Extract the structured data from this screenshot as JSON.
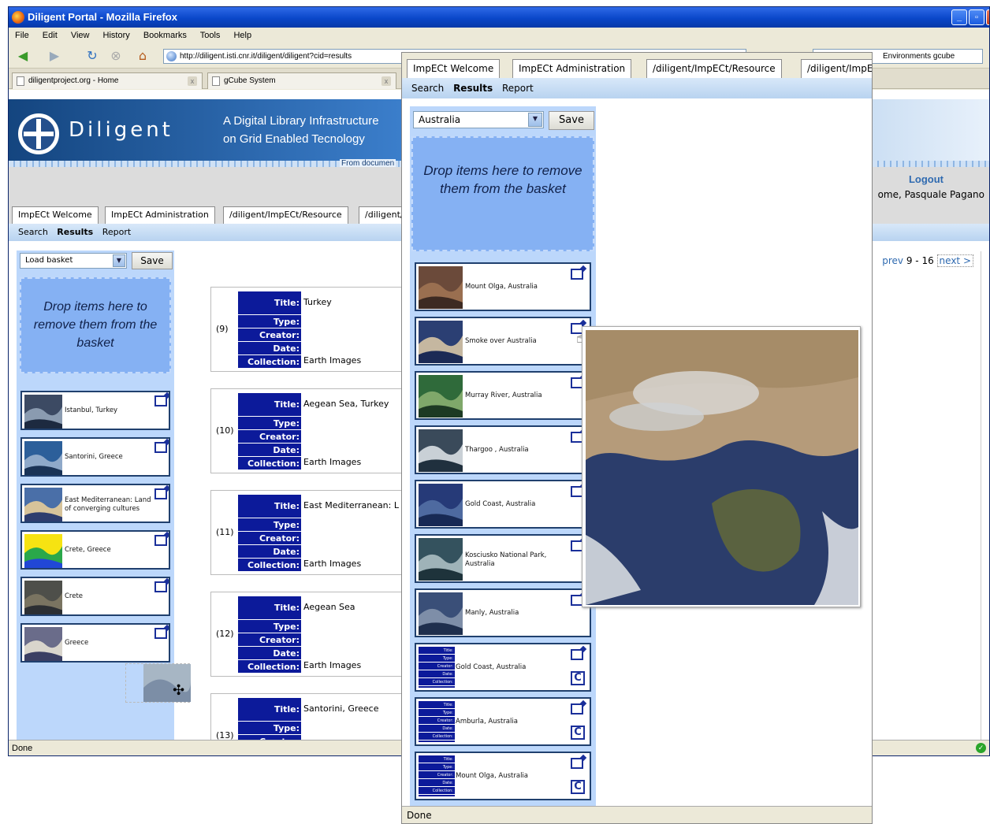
{
  "window": {
    "title": "Diligent Portal - Mozilla Firefox",
    "menu": [
      "File",
      "Edit",
      "View",
      "History",
      "Bookmarks",
      "Tools",
      "Help"
    ],
    "url": "http://diligent.isti.cnr.it/diligent/diligent?cid=results",
    "search_text": "Environments gcube",
    "browser_tabs": [
      "diligentproject.org - Home",
      "gCube System"
    ],
    "status": "Done"
  },
  "banner": {
    "logo_text": "Diligent",
    "tagline_1": "A Digital Library Infrastructure",
    "tagline_2": "on Grid Enabled Tecnology",
    "from_documents": "From documen"
  },
  "user": {
    "logout": "Logout",
    "welcome": "ome, Pasquale Pagano"
  },
  "portal_tabs": [
    "ImpECt Welcome",
    "ImpECt Administration",
    "/diligent/ImpECt/Resource",
    "/diligent/ImpECt/"
  ],
  "subnav": [
    "Search",
    "Results",
    "Report"
  ],
  "paging": {
    "prev": "prev",
    "range": "9 - 16",
    "next": "next >"
  },
  "left_basket": {
    "select_value": "Load basket",
    "save_label": "Save",
    "dropzone": "Drop items here to remove them from the basket",
    "items": [
      {
        "label": "Istanbul, Turkey"
      },
      {
        "label": "Santorini, Greece"
      },
      {
        "label": "East Mediterranean: Land of converging cultures"
      },
      {
        "label": "Crete, Greece"
      },
      {
        "label": "Crete"
      },
      {
        "label": "Greece"
      }
    ]
  },
  "field_labels": {
    "title": "Title:",
    "type": "Type:",
    "creator": "Creator:",
    "date": "Date:",
    "collection": "Collection:"
  },
  "records": [
    {
      "num": "(9)",
      "title": "Turkey",
      "collection": "Earth Images"
    },
    {
      "num": "(10)",
      "title": "Aegean Sea, Turkey",
      "collection": "Earth Images"
    },
    {
      "num": "(11)",
      "title": "East Mediterranean: L",
      "collection": "Earth Images"
    },
    {
      "num": "(12)",
      "title": "Aegean Sea",
      "collection": "Earth Images"
    },
    {
      "num": "(13)",
      "title": "Santorini, Greece",
      "collection": ""
    }
  ],
  "right_window": {
    "select_value": "Australia",
    "save_label": "Save",
    "dropzone": "Drop items here to remove them from the basket",
    "items": [
      {
        "label": "Mount Olga, Australia"
      },
      {
        "label": "Smoke over Australia"
      },
      {
        "label": "Murray River, Australia"
      },
      {
        "label": "Thargoo , Australia"
      },
      {
        "label": "Gold Coast, Australia"
      },
      {
        "label": "Kosciusko National Park, Australia"
      },
      {
        "label": "Manly, Australia"
      },
      {
        "label": "Gold Coast, Australia"
      },
      {
        "label": "Amburla, Australia"
      },
      {
        "label": "Mount Olga, Australia"
      }
    ],
    "status": "Done"
  },
  "mini_record_labels": [
    "Title:",
    "Type:",
    "Creator:",
    "Date:",
    "Collection:"
  ],
  "colors": {
    "record_blue": "#0c1a9a",
    "dropzone": "#85b1f3",
    "subnav": "#b8d3f0"
  }
}
